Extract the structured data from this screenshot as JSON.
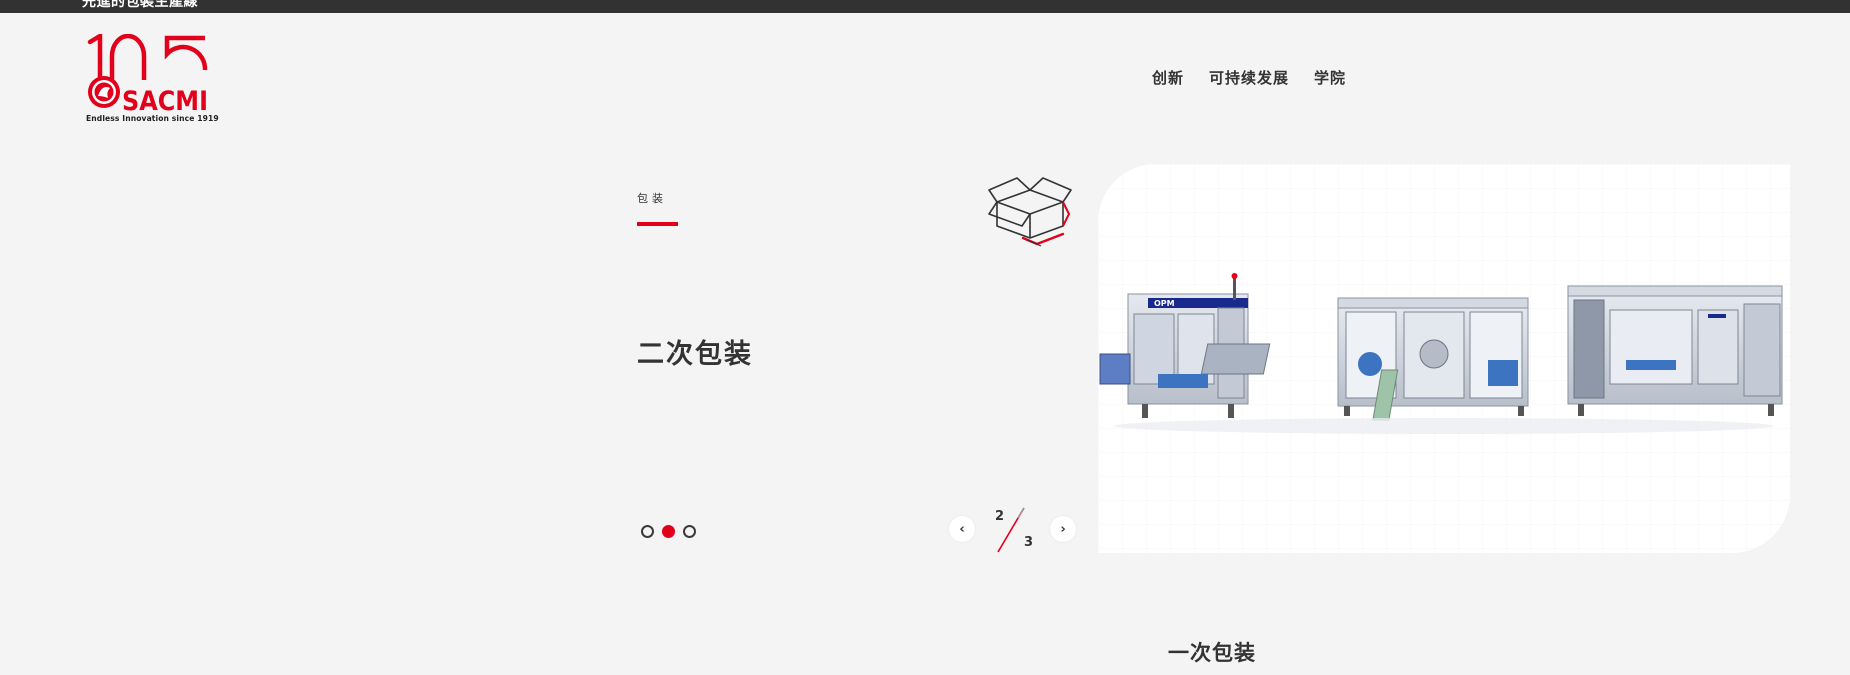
{
  "topbar": {
    "text": "先進的包裝生產線"
  },
  "logo": {
    "number": "105",
    "brand": "SACMI",
    "tagline": "Endless Innovation since 1919",
    "brand_color": "#e2001a"
  },
  "nav": {
    "items": [
      {
        "label": "创新"
      },
      {
        "label": "可持续发展"
      },
      {
        "label": "学院"
      }
    ]
  },
  "slide": {
    "category": "包装",
    "title": "二次包装",
    "icon": "open-box-icon",
    "image_label": "OPM"
  },
  "carousel": {
    "dots": 3,
    "active_index": 1,
    "prev_label": "‹",
    "next_label": "›",
    "current": "2",
    "total": "3"
  },
  "next_section": {
    "title": "一次包装"
  },
  "colors": {
    "accent": "#e2001a",
    "background": "#f4f4f4",
    "topbar": "#323232",
    "text": "#333333"
  }
}
